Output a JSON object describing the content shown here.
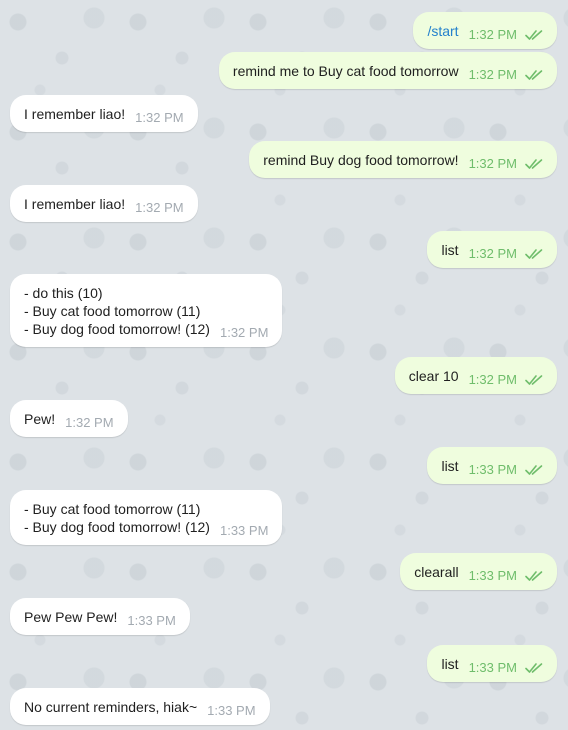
{
  "chat": {
    "messages": [
      {
        "dir": "out",
        "text": "/start",
        "time": "1:32 PM",
        "command": true,
        "status": "read"
      },
      {
        "dir": "out",
        "text": "remind me to Buy cat food tomorrow",
        "time": "1:32 PM",
        "status": "read"
      },
      {
        "dir": "in",
        "text": "I remember liao!",
        "time": "1:32 PM"
      },
      {
        "dir": "out",
        "text": "remind Buy dog food tomorrow!",
        "time": "1:32 PM",
        "status": "read"
      },
      {
        "dir": "in",
        "text": "I remember liao!",
        "time": "1:32 PM"
      },
      {
        "dir": "out",
        "text": "list",
        "time": "1:32 PM",
        "status": "read"
      },
      {
        "dir": "in",
        "text": "- do this (10)\n- Buy cat food tomorrow (11)\n- Buy dog food tomorrow! (12)",
        "time": "1:32 PM"
      },
      {
        "dir": "out",
        "text": "clear 10",
        "time": "1:32 PM",
        "status": "read"
      },
      {
        "dir": "in",
        "text": "Pew!",
        "time": "1:32 PM"
      },
      {
        "dir": "out",
        "text": "list",
        "time": "1:33 PM",
        "status": "read"
      },
      {
        "dir": "in",
        "text": "- Buy cat food tomorrow (11)\n- Buy dog food tomorrow! (12)",
        "time": "1:33 PM"
      },
      {
        "dir": "out",
        "text": "clearall",
        "time": "1:33 PM",
        "status": "read"
      },
      {
        "dir": "in",
        "text": "Pew Pew Pew!",
        "time": "1:33 PM"
      },
      {
        "dir": "out",
        "text": "list",
        "time": "1:33 PM",
        "status": "read"
      },
      {
        "dir": "in",
        "text": "No current reminders, hiak~",
        "time": "1:33 PM"
      }
    ]
  },
  "colors": {
    "outgoing_bubble": "#effdde",
    "incoming_bubble": "#ffffff",
    "read_check": "#6fbd6b",
    "command_link": "#2481cc"
  },
  "icons": {
    "read_status": "double-check-icon"
  }
}
